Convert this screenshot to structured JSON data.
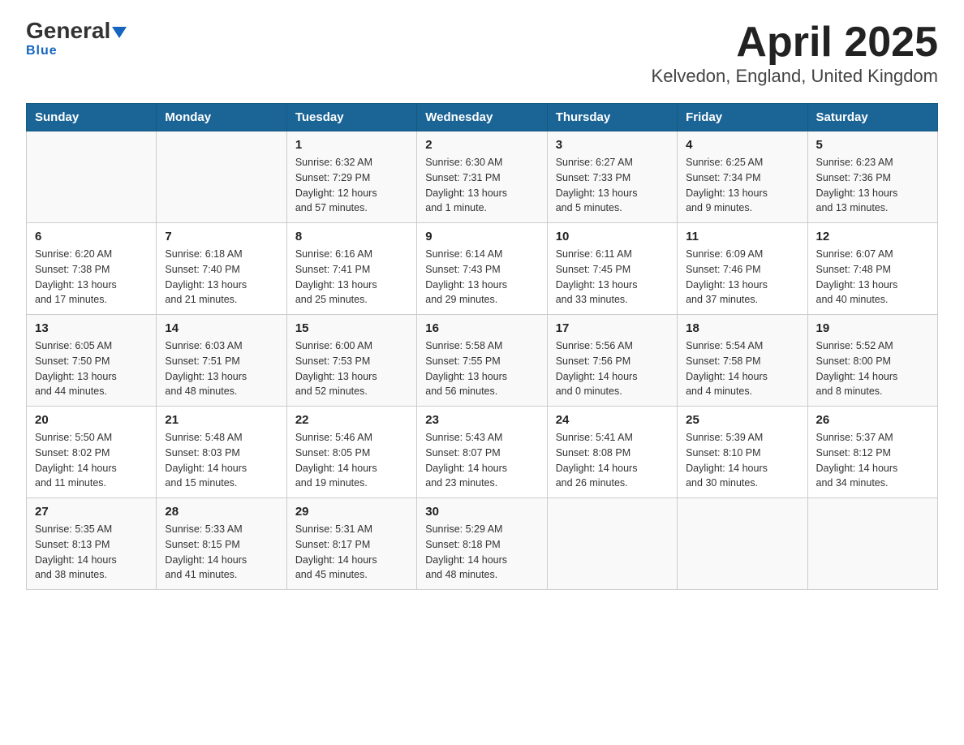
{
  "header": {
    "logo_general": "General",
    "logo_blue": "Blue",
    "title": "April 2025",
    "subtitle": "Kelvedon, England, United Kingdom"
  },
  "days_of_week": [
    "Sunday",
    "Monday",
    "Tuesday",
    "Wednesday",
    "Thursday",
    "Friday",
    "Saturday"
  ],
  "weeks": [
    [
      {
        "day": "",
        "info": ""
      },
      {
        "day": "",
        "info": ""
      },
      {
        "day": "1",
        "info": "Sunrise: 6:32 AM\nSunset: 7:29 PM\nDaylight: 12 hours\nand 57 minutes."
      },
      {
        "day": "2",
        "info": "Sunrise: 6:30 AM\nSunset: 7:31 PM\nDaylight: 13 hours\nand 1 minute."
      },
      {
        "day": "3",
        "info": "Sunrise: 6:27 AM\nSunset: 7:33 PM\nDaylight: 13 hours\nand 5 minutes."
      },
      {
        "day": "4",
        "info": "Sunrise: 6:25 AM\nSunset: 7:34 PM\nDaylight: 13 hours\nand 9 minutes."
      },
      {
        "day": "5",
        "info": "Sunrise: 6:23 AM\nSunset: 7:36 PM\nDaylight: 13 hours\nand 13 minutes."
      }
    ],
    [
      {
        "day": "6",
        "info": "Sunrise: 6:20 AM\nSunset: 7:38 PM\nDaylight: 13 hours\nand 17 minutes."
      },
      {
        "day": "7",
        "info": "Sunrise: 6:18 AM\nSunset: 7:40 PM\nDaylight: 13 hours\nand 21 minutes."
      },
      {
        "day": "8",
        "info": "Sunrise: 6:16 AM\nSunset: 7:41 PM\nDaylight: 13 hours\nand 25 minutes."
      },
      {
        "day": "9",
        "info": "Sunrise: 6:14 AM\nSunset: 7:43 PM\nDaylight: 13 hours\nand 29 minutes."
      },
      {
        "day": "10",
        "info": "Sunrise: 6:11 AM\nSunset: 7:45 PM\nDaylight: 13 hours\nand 33 minutes."
      },
      {
        "day": "11",
        "info": "Sunrise: 6:09 AM\nSunset: 7:46 PM\nDaylight: 13 hours\nand 37 minutes."
      },
      {
        "day": "12",
        "info": "Sunrise: 6:07 AM\nSunset: 7:48 PM\nDaylight: 13 hours\nand 40 minutes."
      }
    ],
    [
      {
        "day": "13",
        "info": "Sunrise: 6:05 AM\nSunset: 7:50 PM\nDaylight: 13 hours\nand 44 minutes."
      },
      {
        "day": "14",
        "info": "Sunrise: 6:03 AM\nSunset: 7:51 PM\nDaylight: 13 hours\nand 48 minutes."
      },
      {
        "day": "15",
        "info": "Sunrise: 6:00 AM\nSunset: 7:53 PM\nDaylight: 13 hours\nand 52 minutes."
      },
      {
        "day": "16",
        "info": "Sunrise: 5:58 AM\nSunset: 7:55 PM\nDaylight: 13 hours\nand 56 minutes."
      },
      {
        "day": "17",
        "info": "Sunrise: 5:56 AM\nSunset: 7:56 PM\nDaylight: 14 hours\nand 0 minutes."
      },
      {
        "day": "18",
        "info": "Sunrise: 5:54 AM\nSunset: 7:58 PM\nDaylight: 14 hours\nand 4 minutes."
      },
      {
        "day": "19",
        "info": "Sunrise: 5:52 AM\nSunset: 8:00 PM\nDaylight: 14 hours\nand 8 minutes."
      }
    ],
    [
      {
        "day": "20",
        "info": "Sunrise: 5:50 AM\nSunset: 8:02 PM\nDaylight: 14 hours\nand 11 minutes."
      },
      {
        "day": "21",
        "info": "Sunrise: 5:48 AM\nSunset: 8:03 PM\nDaylight: 14 hours\nand 15 minutes."
      },
      {
        "day": "22",
        "info": "Sunrise: 5:46 AM\nSunset: 8:05 PM\nDaylight: 14 hours\nand 19 minutes."
      },
      {
        "day": "23",
        "info": "Sunrise: 5:43 AM\nSunset: 8:07 PM\nDaylight: 14 hours\nand 23 minutes."
      },
      {
        "day": "24",
        "info": "Sunrise: 5:41 AM\nSunset: 8:08 PM\nDaylight: 14 hours\nand 26 minutes."
      },
      {
        "day": "25",
        "info": "Sunrise: 5:39 AM\nSunset: 8:10 PM\nDaylight: 14 hours\nand 30 minutes."
      },
      {
        "day": "26",
        "info": "Sunrise: 5:37 AM\nSunset: 8:12 PM\nDaylight: 14 hours\nand 34 minutes."
      }
    ],
    [
      {
        "day": "27",
        "info": "Sunrise: 5:35 AM\nSunset: 8:13 PM\nDaylight: 14 hours\nand 38 minutes."
      },
      {
        "day": "28",
        "info": "Sunrise: 5:33 AM\nSunset: 8:15 PM\nDaylight: 14 hours\nand 41 minutes."
      },
      {
        "day": "29",
        "info": "Sunrise: 5:31 AM\nSunset: 8:17 PM\nDaylight: 14 hours\nand 45 minutes."
      },
      {
        "day": "30",
        "info": "Sunrise: 5:29 AM\nSunset: 8:18 PM\nDaylight: 14 hours\nand 48 minutes."
      },
      {
        "day": "",
        "info": ""
      },
      {
        "day": "",
        "info": ""
      },
      {
        "day": "",
        "info": ""
      }
    ]
  ]
}
